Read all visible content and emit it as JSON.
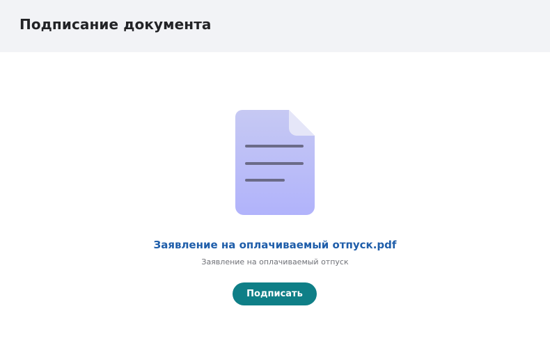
{
  "header": {
    "title": "Подписание документа"
  },
  "document": {
    "icon": "document-icon",
    "file_name": "Заявление на оплачиваемый отпуск.pdf",
    "description": "Заявление на оплачиваемый отпуск"
  },
  "actions": {
    "sign_label": "Подписать"
  },
  "colors": {
    "header_bg": "#f2f3f6",
    "link": "#1f5eaa",
    "button": "#0f7f87",
    "icon_gradient_top": "#c6c9f3",
    "icon_gradient_bottom": "#b1b3fb",
    "icon_lines": "#6b6b88"
  }
}
